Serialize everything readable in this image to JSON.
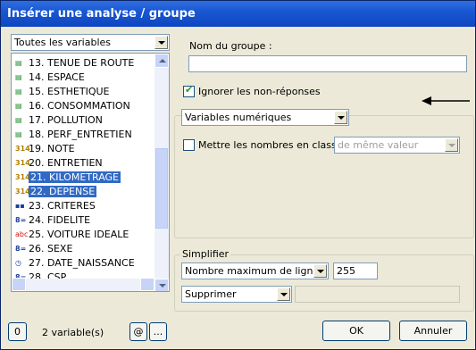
{
  "window": {
    "title": "Insérer une analyse / groupe"
  },
  "filter": {
    "selected": "Toutes les variables"
  },
  "variables": [
    {
      "icon": "bars",
      "glyph": "▤",
      "label": "13. TENUE DE ROUTE",
      "selected": false
    },
    {
      "icon": "bars",
      "glyph": "▤",
      "label": "14. ESPACE",
      "selected": false
    },
    {
      "icon": "bars",
      "glyph": "▤",
      "label": "15. ESTHETIQUE",
      "selected": false
    },
    {
      "icon": "bars",
      "glyph": "▤",
      "label": "16. CONSOMMATION",
      "selected": false
    },
    {
      "icon": "bars",
      "glyph": "▤",
      "label": "17. POLLUTION",
      "selected": false
    },
    {
      "icon": "bars",
      "glyph": "▤",
      "label": "18. PERF_ENTRETIEN",
      "selected": false
    },
    {
      "icon": "number",
      "glyph": "314",
      "label": "19. NOTE",
      "selected": false
    },
    {
      "icon": "number",
      "glyph": "314",
      "label": "20. ENTRETIEN",
      "selected": false
    },
    {
      "icon": "number",
      "glyph": "314",
      "label": "21. KILOMETRAGE",
      "selected": true
    },
    {
      "icon": "number",
      "glyph": "314",
      "label": "22. DEPENSE",
      "selected": true
    },
    {
      "icon": "multi-choice",
      "glyph": "▪▪",
      "label": "23. CRITERES",
      "selected": false
    },
    {
      "icon": "single-choice",
      "glyph": "8=",
      "label": "24. FIDELITE",
      "selected": false
    },
    {
      "icon": "text",
      "glyph": "abc",
      "label": "25. VOITURE IDEALE",
      "selected": false
    },
    {
      "icon": "single-choice",
      "glyph": "8=",
      "label": "26. SEXE",
      "selected": false
    },
    {
      "icon": "date",
      "glyph": "◷",
      "label": "27. DATE_NAISSANCE",
      "selected": false
    },
    {
      "icon": "single-choice",
      "glyph": "8=",
      "label": "28. CSP",
      "selected": false
    }
  ],
  "group": {
    "name_label": "Nom du groupe :",
    "name_value": "",
    "ignore_label": "Ignorer les non-réponses",
    "ignore_checked": true,
    "type_selected": "Variables numériques",
    "classes_label": "Mettre les nombres en classes",
    "classes_checked": false,
    "classes_mode": "de même valeur"
  },
  "simplify": {
    "title": "Simplifier",
    "criterion": "Nombre maximum de lignes",
    "max_value": "255",
    "action": "Supprimer",
    "extra_value": ""
  },
  "footer": {
    "zero_button": "0",
    "count_text": "2 variable(s)",
    "at_button": "@",
    "more_button": "...",
    "ok": "OK",
    "cancel": "Annuler"
  }
}
